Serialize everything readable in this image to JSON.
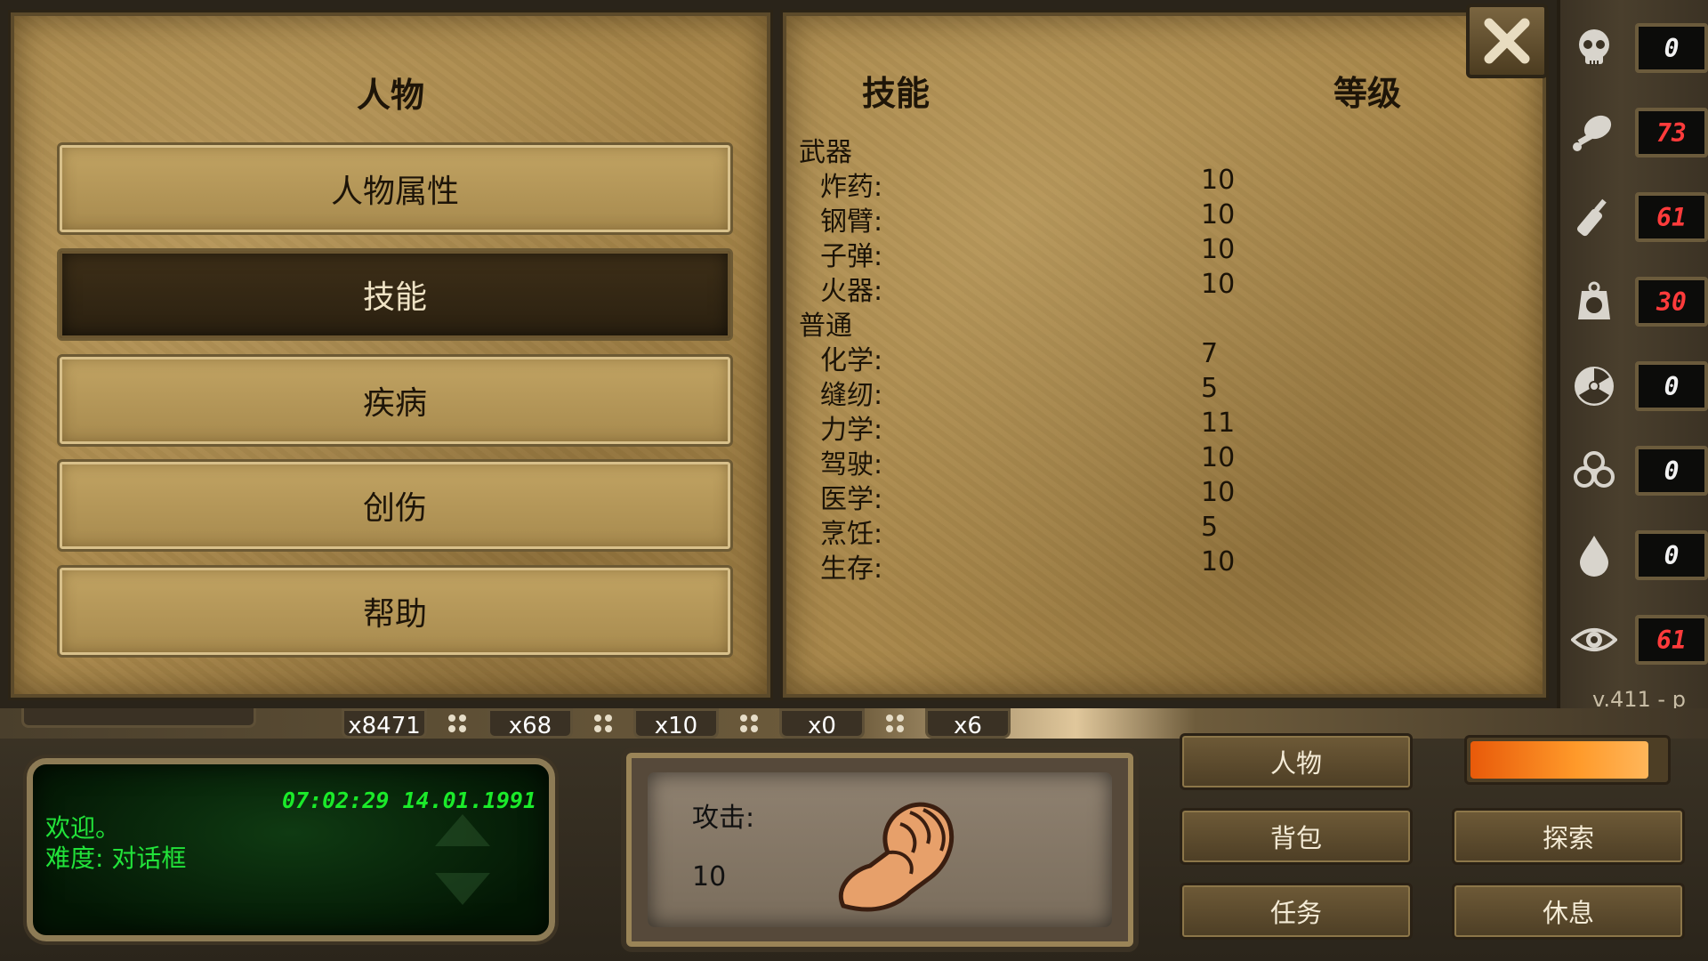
{
  "left_panel": {
    "title": "人物",
    "menu": [
      {
        "label": "人物属性",
        "active": false
      },
      {
        "label": "技能",
        "active": true
      },
      {
        "label": "疾病",
        "active": false
      },
      {
        "label": "创伤",
        "active": false
      },
      {
        "label": "帮助",
        "active": false
      }
    ]
  },
  "skills_panel": {
    "header_skill": "技能",
    "header_level": "等级",
    "categories": [
      {
        "name": "武器",
        "skills": [
          {
            "name": "炸药:",
            "level": "10"
          },
          {
            "name": "钢臂:",
            "level": "10"
          },
          {
            "name": "子弹:",
            "level": "10"
          },
          {
            "name": "火器:",
            "level": "10"
          }
        ]
      },
      {
        "name": "普通",
        "skills": [
          {
            "name": "化学:",
            "level": "7"
          },
          {
            "name": "缝纫:",
            "level": "5"
          },
          {
            "name": "力学:",
            "level": "11"
          },
          {
            "name": "驾驶:",
            "level": "10"
          },
          {
            "name": "医学:",
            "level": "10"
          },
          {
            "name": "烹饪:",
            "level": "5"
          },
          {
            "name": "生存:",
            "level": "10"
          }
        ]
      }
    ]
  },
  "status": [
    {
      "icon": "skull-icon",
      "value": "0",
      "color": "#f2f2f2"
    },
    {
      "icon": "meat-icon",
      "value": "73",
      "color": "#ff3b3b"
    },
    {
      "icon": "bottle-icon",
      "value": "61",
      "color": "#ff3b3b"
    },
    {
      "icon": "weight-icon",
      "value": "30",
      "color": "#ff3b3b"
    },
    {
      "icon": "radiation-icon",
      "value": "0",
      "color": "#f2f2f2"
    },
    {
      "icon": "biohazard-icon",
      "value": "0",
      "color": "#f2f2f2"
    },
    {
      "icon": "drop-icon",
      "value": "0",
      "color": "#f2f2f2"
    },
    {
      "icon": "eye-icon",
      "value": "61",
      "color": "#ff3b3b"
    }
  ],
  "version": "v.411 - p",
  "items": [
    "x8471",
    "x68",
    "x10",
    "x0",
    "x6"
  ],
  "console": {
    "time": "07:02:29  14.01.1991",
    "line1": "欢迎。",
    "line2": "难度: 对话框"
  },
  "attack": {
    "label": "攻击:",
    "value": "10"
  },
  "actions": {
    "character": "人物",
    "explore": "探索",
    "backpack": "背包",
    "quests": "任务",
    "rest": "休息"
  },
  "progress_fraction": 0.92
}
